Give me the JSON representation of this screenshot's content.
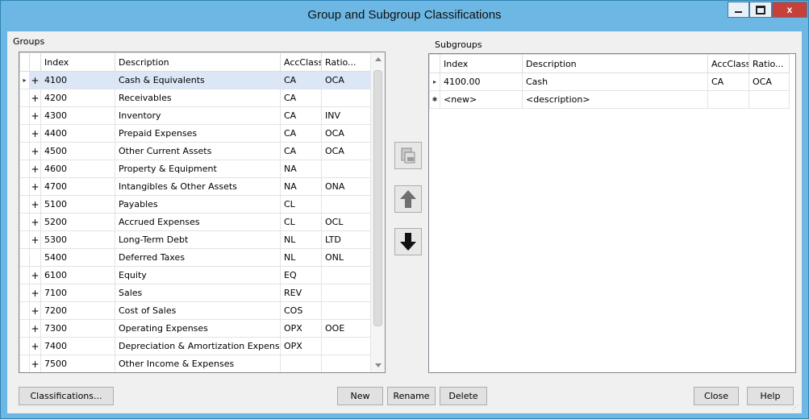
{
  "window": {
    "title": "Group and Subgroup Classifications",
    "close_glyph": "x"
  },
  "groups": {
    "label": "Groups",
    "columns": [
      "Index",
      "Description",
      "AccClass",
      "Ratio..."
    ],
    "rows": [
      {
        "marker": "▸",
        "expand": "+",
        "index": "4100",
        "description": "Cash & Equivalents",
        "accclass": "CA",
        "ratio": "OCA"
      },
      {
        "marker": "",
        "expand": "+",
        "index": "4200",
        "description": "Receivables",
        "accclass": "CA",
        "ratio": ""
      },
      {
        "marker": "",
        "expand": "+",
        "index": "4300",
        "description": "Inventory",
        "accclass": "CA",
        "ratio": "INV"
      },
      {
        "marker": "",
        "expand": "+",
        "index": "4400",
        "description": "Prepaid Expenses",
        "accclass": "CA",
        "ratio": "OCA"
      },
      {
        "marker": "",
        "expand": "+",
        "index": "4500",
        "description": "Other Current Assets",
        "accclass": "CA",
        "ratio": "OCA"
      },
      {
        "marker": "",
        "expand": "+",
        "index": "4600",
        "description": "Property & Equipment",
        "accclass": "NA",
        "ratio": ""
      },
      {
        "marker": "",
        "expand": "+",
        "index": "4700",
        "description": "Intangibles & Other Assets",
        "accclass": "NA",
        "ratio": "ONA"
      },
      {
        "marker": "",
        "expand": "+",
        "index": "5100",
        "description": "Payables",
        "accclass": "CL",
        "ratio": ""
      },
      {
        "marker": "",
        "expand": "+",
        "index": "5200",
        "description": "Accrued Expenses",
        "accclass": "CL",
        "ratio": "OCL"
      },
      {
        "marker": "",
        "expand": "+",
        "index": "5300",
        "description": "Long-Term Debt",
        "accclass": "NL",
        "ratio": "LTD"
      },
      {
        "marker": "",
        "expand": "",
        "index": "5400",
        "description": "Deferred Taxes",
        "accclass": "NL",
        "ratio": "ONL"
      },
      {
        "marker": "",
        "expand": "+",
        "index": "6100",
        "description": "Equity",
        "accclass": "EQ",
        "ratio": ""
      },
      {
        "marker": "",
        "expand": "+",
        "index": "7100",
        "description": "Sales",
        "accclass": "REV",
        "ratio": ""
      },
      {
        "marker": "",
        "expand": "+",
        "index": "7200",
        "description": "Cost of Sales",
        "accclass": "COS",
        "ratio": ""
      },
      {
        "marker": "",
        "expand": "+",
        "index": "7300",
        "description": "Operating Expenses",
        "accclass": "OPX",
        "ratio": "OOE"
      },
      {
        "marker": "",
        "expand": "+",
        "index": "7400",
        "description": "Depreciation & Amortization Expense",
        "accclass": "OPX",
        "ratio": ""
      },
      {
        "marker": "",
        "expand": "+",
        "index": "7500",
        "description": "Other Income & Expenses",
        "accclass": "",
        "ratio": ""
      }
    ]
  },
  "subgroups": {
    "label": "Subgroups",
    "columns": [
      "Index",
      "Description",
      "AccClass",
      "Ratio..."
    ],
    "rows": [
      {
        "marker": "▸",
        "index": "4100.00",
        "description": "Cash",
        "accclass": "CA",
        "ratio": "OCA"
      },
      {
        "marker": "✱",
        "index": "<new>",
        "description": "<description>",
        "accclass": "",
        "ratio": ""
      }
    ]
  },
  "buttons": {
    "classifications": "Classifications...",
    "new": "New",
    "rename": "Rename",
    "delete": "Delete",
    "close": "Close",
    "help": "Help"
  },
  "icons": {
    "move_to_subgroup": "folder-move-icon",
    "move_up": "arrow-up-icon",
    "move_down": "arrow-down-icon"
  },
  "colors": {
    "titlebar": "#6cb7e3",
    "close_button": "#c7413a",
    "selected_row": "#dbe7f7"
  }
}
